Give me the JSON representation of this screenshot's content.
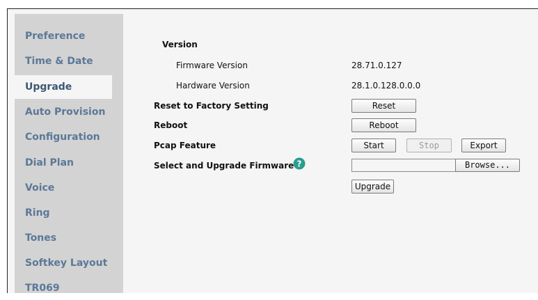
{
  "sidebar": {
    "items": [
      {
        "label": "Preference"
      },
      {
        "label": "Time & Date"
      },
      {
        "label": "Upgrade",
        "active": true
      },
      {
        "label": "Auto Provision"
      },
      {
        "label": "Configuration"
      },
      {
        "label": "Dial Plan"
      },
      {
        "label": "Voice"
      },
      {
        "label": "Ring"
      },
      {
        "label": "Tones"
      },
      {
        "label": "Softkey Layout"
      },
      {
        "label": "TR069"
      }
    ]
  },
  "main": {
    "version_heading": "Version",
    "firmware_label": "Firmware Version",
    "firmware_value": "28.71.0.127",
    "hardware_label": "Hardware Version",
    "hardware_value": "28.1.0.128.0.0.0",
    "reset_label": "Reset to Factory Setting",
    "reset_button": "Reset",
    "reboot_label": "Reboot",
    "reboot_button": "Reboot",
    "pcap_label": "Pcap Feature",
    "pcap_start": "Start",
    "pcap_stop": "Stop",
    "pcap_export": "Export",
    "upgrade_label": "Select and Upgrade Firmware",
    "help_icon": "question-circle-icon",
    "browse_button": "Browse...",
    "upgrade_button": "Upgrade"
  },
  "colors": {
    "nav_text": "#5b7898",
    "sidebar_bg": "#d3d3d3",
    "content_bg": "#f5f5f5",
    "help_icon": "#2a9d8f"
  }
}
